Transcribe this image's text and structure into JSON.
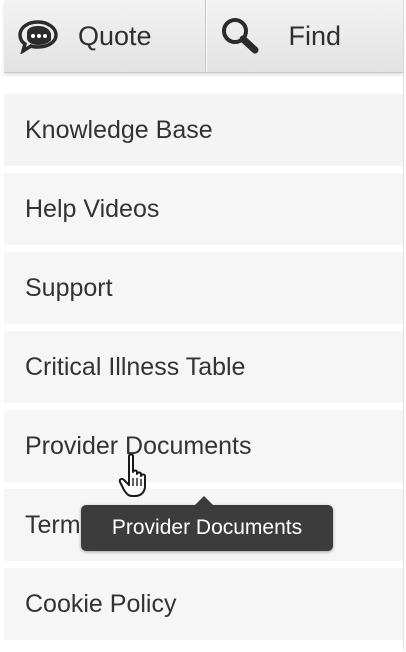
{
  "toolbar": {
    "quote_label": "Quote",
    "find_label": "Find",
    "quote_icon": "speech-bubble-icon",
    "find_icon": "magnifier-icon"
  },
  "menu": {
    "items": [
      {
        "label": "Knowledge Base"
      },
      {
        "label": "Help Videos"
      },
      {
        "label": "Support"
      },
      {
        "label": "Critical Illness Table"
      },
      {
        "label": "Provider Documents"
      },
      {
        "label": "Term"
      },
      {
        "label": "Cookie Policy"
      }
    ]
  },
  "tooltip": {
    "text": "Provider Documents"
  },
  "cursor": {
    "icon": "hand-pointer-icon"
  },
  "colors": {
    "toolbar_bg": "#e8e8e8",
    "item_bg": "#f6f6f6",
    "tooltip_bg": "#3c3c3c",
    "text": "#333333"
  }
}
